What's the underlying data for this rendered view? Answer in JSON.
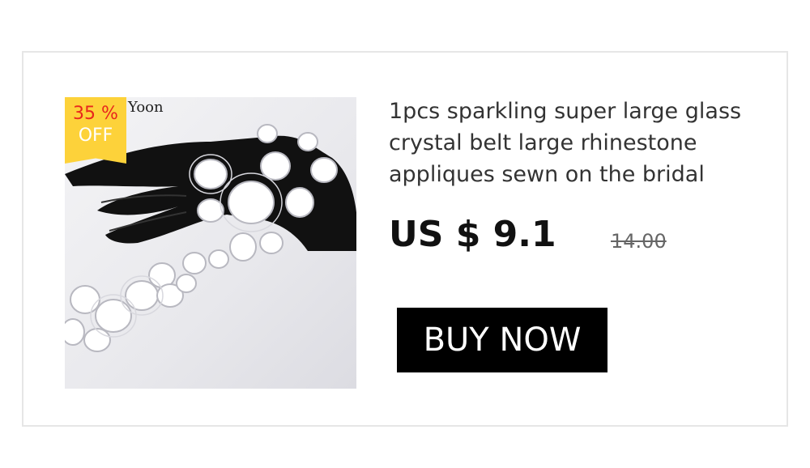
{
  "product": {
    "brand_mark": "Yoon",
    "title": "1pcs sparkling super large glass crystal belt large rhinestone appliques sewn on the bridal",
    "price": "US $ 9.1",
    "old_price": "14.00",
    "discount_percent": "35 %",
    "discount_label": "OFF",
    "buy_label": "BUY NOW",
    "image_alt": "crystal rhinestone applique on black mannequin hand"
  },
  "colors": {
    "badge": "#fdd23a",
    "badge_percent_text": "#e8261d",
    "button_bg": "#000000",
    "button_text": "#ffffff"
  }
}
